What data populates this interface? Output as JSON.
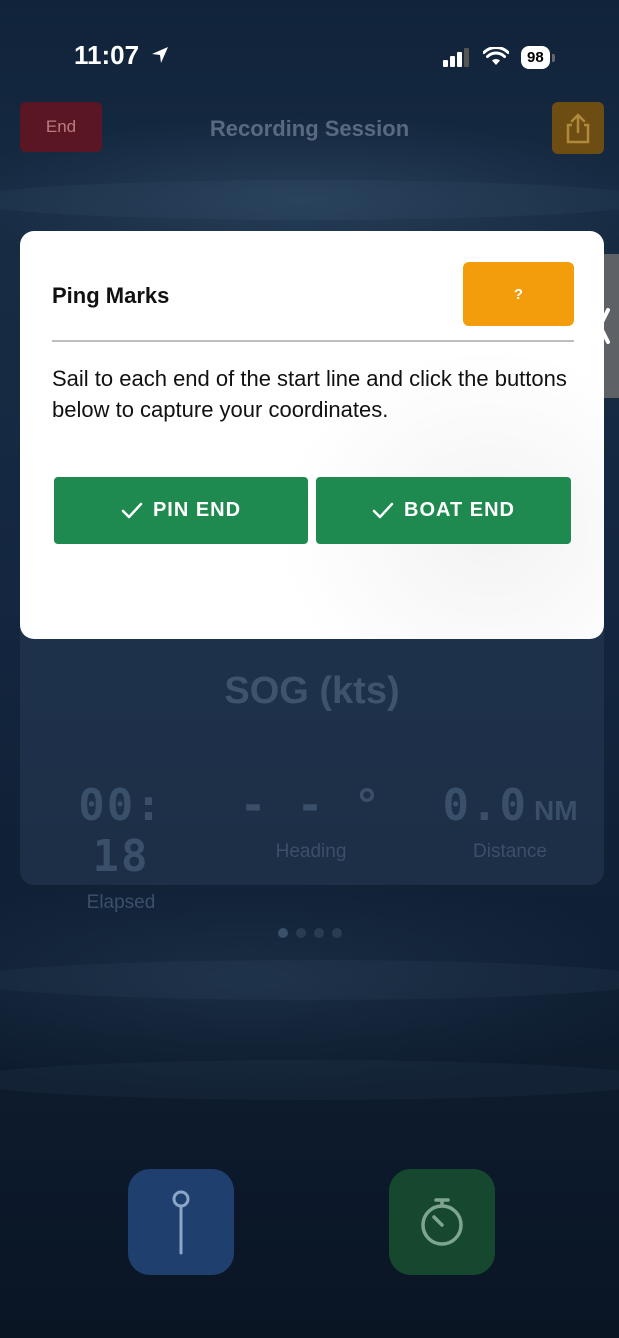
{
  "status_bar": {
    "time": "11:07",
    "battery": "98"
  },
  "navbar": {
    "end_label": "End",
    "title": "Recording Session"
  },
  "dashboard": {
    "sog_label": "SOG (kts)",
    "elapsed_value": "00: 18",
    "elapsed_label": "Elapsed",
    "heading_value": "- -  °",
    "heading_label": "Heading",
    "distance_value": "0.0",
    "distance_unit": "NM",
    "distance_label": "Distance"
  },
  "page_indicator": {
    "count": 4,
    "active": 0
  },
  "modal": {
    "title": "Ping Marks",
    "help_label": "?",
    "description": "Sail to each end of the start line and click the buttons below to capture your coordinates.",
    "pin_end_label": "PIN END",
    "boat_end_label": "BOAT END"
  },
  "icons": {
    "location": "location-arrow-icon",
    "signal": "cellular-signal-icon",
    "wifi": "wifi-icon",
    "share": "share-icon",
    "chevron": "chevron-left-icon",
    "check": "checkmark-icon",
    "pin": "pin-icon",
    "timer": "stopwatch-icon"
  },
  "colors": {
    "end_button": "#5a1622",
    "share_button": "#6d4d12",
    "help_button": "#f39c0c",
    "action_button": "#1f8a4f",
    "pin_button": "#1f3f6e",
    "timer_button": "#15482f"
  }
}
